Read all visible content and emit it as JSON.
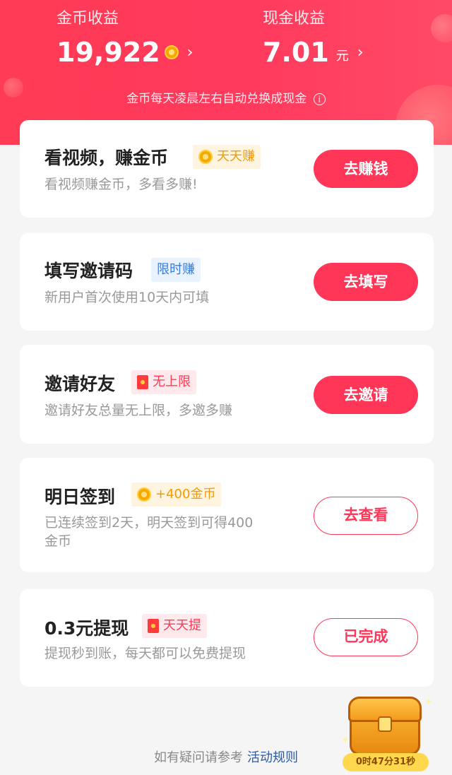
{
  "header": {
    "coin_label": "金币收益",
    "coin_value": "19,922",
    "cash_label": "现金收益",
    "cash_value": "7.01",
    "cash_unit": "元",
    "notice": "金币每天凌晨左右自动兑换成现金",
    "chevron": "›",
    "info_glyph": "i"
  },
  "tasks": [
    {
      "title": "看视频，赚金币",
      "tag": "天天赚",
      "tag_icon": "coin-icon",
      "desc": "看视频赚金币，多看多赚!",
      "button": "去赚钱"
    },
    {
      "title": "填写邀请码",
      "tag": "限时赚",
      "desc": "新用户首次使用10天内可填",
      "button": "去填写"
    },
    {
      "title": "邀请好友",
      "tag": "无上限",
      "tag_icon": "red-packet-icon",
      "desc": "邀请好友总量无上限，多邀多赚",
      "button": "去邀请"
    },
    {
      "title": "明日签到",
      "tag": "+400金币",
      "tag_icon": "coin-icon",
      "desc_line1": "已连续签到2天，明天签到可得400",
      "desc_line2": "金币",
      "button": "去查看"
    },
    {
      "title": "0.3元提现",
      "tag": "天天提",
      "tag_icon": "red-packet-icon",
      "desc": "提现秒到账，每天都可以免费提现",
      "button": "已完成"
    }
  ],
  "footer": {
    "text": "如有疑问请参考",
    "link": "活动规则"
  },
  "chest": {
    "timer": "0时47分31秒"
  },
  "colors": {
    "accent": "#ff3658",
    "header_bg": "#ff3b55"
  }
}
